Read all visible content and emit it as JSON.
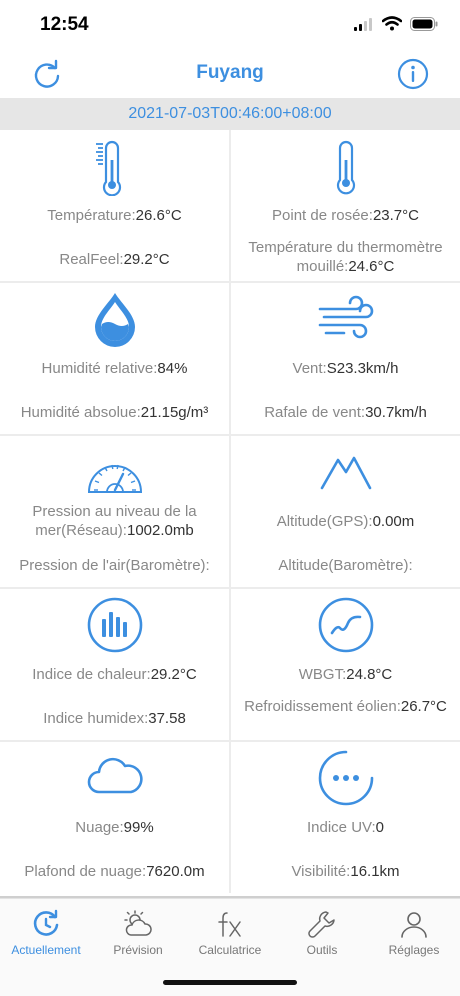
{
  "status_bar": {
    "time": "12:54"
  },
  "header": {
    "title": "Fuyang",
    "refresh_icon": "refresh-icon",
    "info_icon": "info-icon"
  },
  "date": "2021-07-03T00:46:00+08:00",
  "accent_color": "#3d8fe0",
  "cells": [
    {
      "icon": "thermometer-scale-icon",
      "l1_label": "Température:",
      "l1_value": "26.6°C",
      "l2_label": "RealFeel:",
      "l2_value": "29.2°C"
    },
    {
      "icon": "thermometer-icon",
      "l1_label": "Point de rosée:",
      "l1_value": "23.7°C",
      "l2_label": "Température du thermomètre mouillé:",
      "l2_value": "24.6°C"
    },
    {
      "icon": "water-drop-icon",
      "l1_label": "Humidité relative:",
      "l1_value": "84%",
      "l2_label": "Humidité absolue:",
      "l2_value": "21.15g/m³"
    },
    {
      "icon": "wind-icon",
      "l1_label": "Vent:",
      "l1_value": "S23.3km/h",
      "l2_label": "Rafale de vent:",
      "l2_value": "30.7km/h"
    },
    {
      "icon": "gauge-icon",
      "l1_label": "Pression au niveau de la mer(Réseau):",
      "l1_value": "1002.0mb",
      "l2_label": "Pression de l'air(Baromètre):",
      "l2_value": ""
    },
    {
      "icon": "mountain-icon",
      "l1_label": "Altitude(GPS):",
      "l1_value": "0.00m",
      "l2_label": "Altitude(Baromètre):",
      "l2_value": ""
    },
    {
      "icon": "bar-chart-icon",
      "l1_label": "Indice de chaleur:",
      "l1_value": "29.2°C",
      "l2_label": "Indice humidex:",
      "l2_value": "37.58"
    },
    {
      "icon": "wave-circle-icon",
      "l1_label": "WBGT:",
      "l1_value": "24.8°C",
      "l2_label": "Refroidissement éolien:",
      "l2_value": "26.7°C"
    },
    {
      "icon": "cloud-icon",
      "l1_label": "Nuage:",
      "l1_value": "99%",
      "l2_label": "Plafond de nuage:",
      "l2_value": "7620.0m"
    },
    {
      "icon": "more-circle-icon",
      "l1_label": "Indice UV:",
      "l1_value": "0",
      "l2_label": "Visibilité:",
      "l2_value": "16.1km"
    }
  ],
  "tabs": [
    {
      "label": "Actuellement",
      "icon": "clock-refresh-icon",
      "active": true
    },
    {
      "label": "Prévision",
      "icon": "sun-cloud-icon",
      "active": false
    },
    {
      "label": "Calculatrice",
      "icon": "fx-icon",
      "active": false
    },
    {
      "label": "Outils",
      "icon": "wrench-icon",
      "active": false
    },
    {
      "label": "Réglages",
      "icon": "person-icon",
      "active": false
    }
  ]
}
